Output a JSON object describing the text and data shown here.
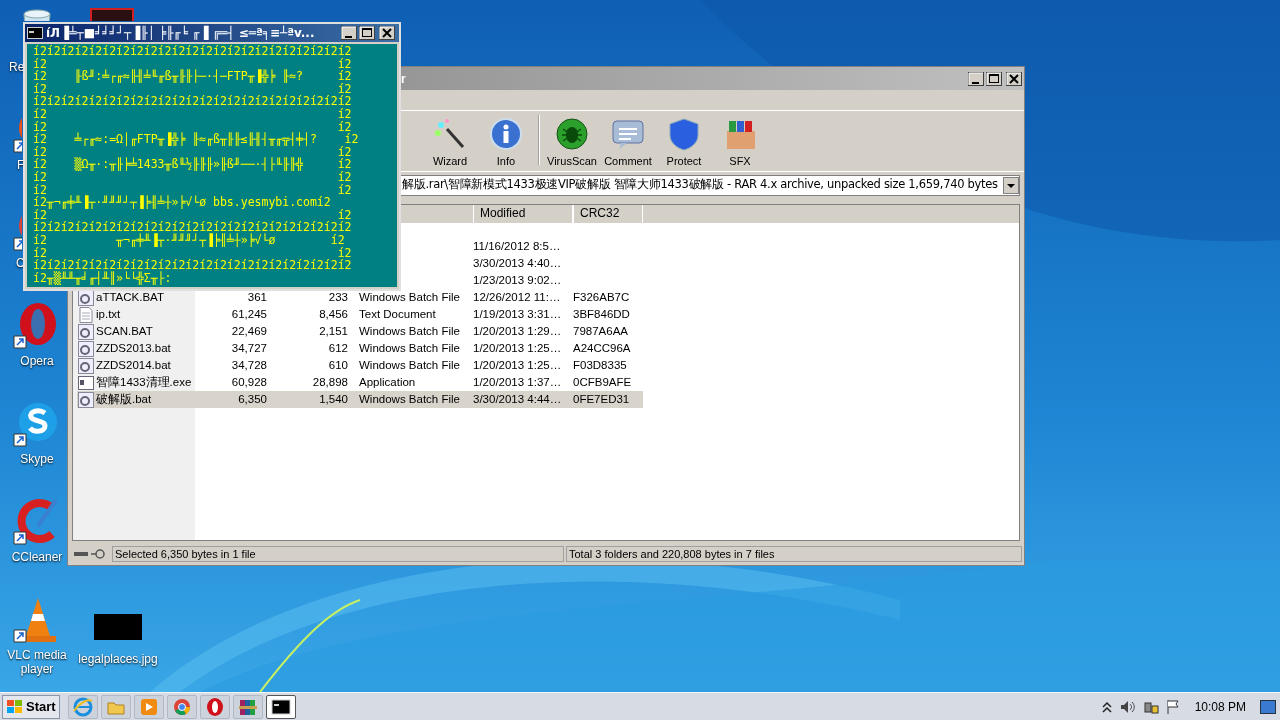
{
  "desktop_icons": [
    {
      "label": "Re",
      "kind": "recycle"
    },
    {
      "label": "F",
      "kind": "firefox"
    },
    {
      "label": "C",
      "kind": "chrome"
    },
    {
      "label": "Opera",
      "kind": "opera"
    },
    {
      "label": "Skype",
      "kind": "skype"
    },
    {
      "label": "CCleaner",
      "kind": "ccleaner"
    },
    {
      "label": "VLC media player",
      "kind": "vlc"
    }
  ],
  "desktop_file": {
    "label": "legalplaces.jpg"
  },
  "console": {
    "title": "íЛ▐╧┬■╛╛╛┘┬▐╟│ ╞╟╓╘ ╓▐ ╔═┤ ≤═ª╕≡┴ªv...",
    "lines": [
      "í2í2í2í2í2í2í2í2í2í2í2í2í2í2í2í2í2í2í2í2í2í2í2",
      "í2                                          í2",
      "í2    ╟ß╜:╧┌╓≈╟╢╧╙╓ß╥╟╟├─·┤─FTP╥▐╬╞ ╟≈?     í2",
      "í2                                          í2",
      "í2í2í2í2í2í2í2í2í2í2í2í2í2í2í2í2í2í2í2í2í2í2í2",
      "í2                                          í2",
      "í2                                          í2",
      "í2    ╧┌╓≈:=Ω│╓FTP╥▐╬╞ ╟≈╓ß╥╟╟≤╟╢┤╥╓╦┤╪┤?    í2",
      "í2                                          í2",
      "í2    ▒Ω╥·:╥╟╞╧1433╥ß╙½╟╟╟»╟ß╜──·┤├╙╟╟╬     í2",
      "í2                                          í2",
      "í2                                          í2",
      "í2╥¬╓╪╨▐┬·╜╜╜┘┬▐╞╢╧┼»╞√└ø bbs.yesmybi.comí2",
      "í2                                          í2",
      "í2í2í2í2í2í2í2í2í2í2í2í2í2í2í2í2í2í2í2í2í2í2í2",
      "í2          ╥¬╓╪╨▐┬·╜╜╜┘┬▐╞╢╧┼»╞√└ø        í2",
      "í2                                          í2",
      "í2í2í2í2í2í2í2í2í2í2í2í2í2í2í2í2í2í2í2í2í2í2í2",
      "í2╥▒╨╨╥╛╓┤╨║»└└╬Σ╥├:"
    ]
  },
  "winrar": {
    "title": "r",
    "toolbar": [
      {
        "label": "Wizard",
        "kind": "wizard"
      },
      {
        "label": "Info",
        "kind": "info"
      },
      {
        "label": "VirusScan",
        "kind": "virus"
      },
      {
        "label": "Comment",
        "kind": "comment"
      },
      {
        "label": "Protect",
        "kind": "protect"
      },
      {
        "label": "SFX",
        "kind": "sfx"
      }
    ],
    "path": "解版.rar\\智障新模式1433极速VIP破解版 智障大师1433破解版 - RAR 4.x archive, unpacked size 1,659,740 bytes",
    "columns": [
      "Modified",
      "CRC32"
    ],
    "rows": [
      {
        "modified": "11/16/2012 8:5…",
        "selected": false
      },
      {
        "modified": "3/30/2013 4:40…",
        "selected": false
      },
      {
        "modified": "1/23/2013 9:02…",
        "selected": false
      },
      {
        "kind": "batch",
        "name": "aTTACK.BAT",
        "size": "361",
        "packed": "233",
        "type": "Windows Batch File",
        "modified": "12/26/2012 11:…",
        "crc": "F326AB7C",
        "selected": false
      },
      {
        "kind": "text",
        "name": "ip.txt",
        "size": "61,245",
        "packed": "8,456",
        "type": "Text Document",
        "modified": "1/19/2013 3:31…",
        "crc": "3BF846DD",
        "selected": false
      },
      {
        "kind": "batch",
        "name": "SCAN.BAT",
        "size": "22,469",
        "packed": "2,151",
        "type": "Windows Batch File",
        "modified": "1/20/2013 1:29…",
        "crc": "7987A6AA",
        "selected": false
      },
      {
        "kind": "batch",
        "name": "ZZDS2013.bat",
        "size": "34,727",
        "packed": "612",
        "type": "Windows Batch File",
        "modified": "1/20/2013 1:25…",
        "crc": "A24CC96A",
        "selected": false
      },
      {
        "kind": "batch",
        "name": "ZZDS2014.bat",
        "size": "34,728",
        "packed": "610",
        "type": "Windows Batch File",
        "modified": "1/20/2013 1:25…",
        "crc": "F03D8335",
        "selected": false
      },
      {
        "kind": "app",
        "name": "智障1433清理.exe",
        "size": "60,928",
        "packed": "28,898",
        "type": "Application",
        "modified": "1/20/2013 1:37…",
        "crc": "0CFB9AFE",
        "selected": false
      },
      {
        "kind": "batch",
        "name": "破解版.bat",
        "size": "6,350",
        "packed": "1,540",
        "type": "Windows Batch File",
        "modified": "3/30/2013 4:44…",
        "crc": "0FE7ED31",
        "selected": true
      }
    ],
    "status_left": "Selected 6,350 bytes in 1 file",
    "status_right": "Total 3 folders and 220,808 bytes in 7 files"
  },
  "taskbar": {
    "start": "Start",
    "apps": [
      {
        "kind": "ie",
        "selected": false
      },
      {
        "kind": "explorer",
        "selected": false
      },
      {
        "kind": "media",
        "selected": false
      },
      {
        "kind": "chrome",
        "selected": false
      },
      {
        "kind": "opera",
        "selected": false
      },
      {
        "kind": "winrar",
        "selected": false
      },
      {
        "kind": "cmd",
        "selected": true
      }
    ],
    "clock": "10:08 PM"
  }
}
